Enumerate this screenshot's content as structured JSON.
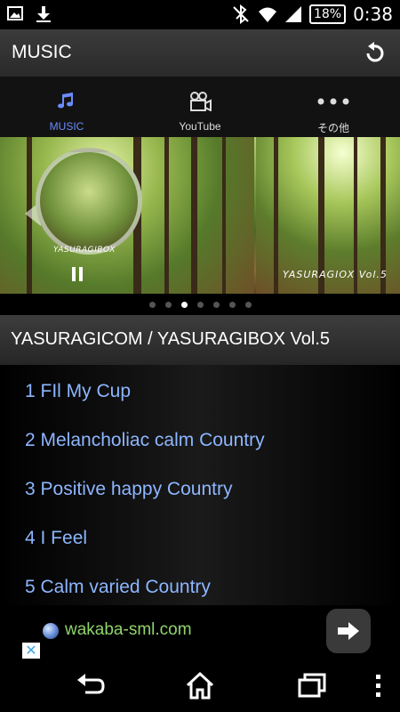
{
  "status_bar": {
    "battery": "18%",
    "time": "0:38",
    "icons": [
      "image-icon",
      "download-icon",
      "bluetooth-off-icon",
      "wifi-icon",
      "signal-icon",
      "battery-icon"
    ]
  },
  "action_bar": {
    "title": "MUSIC",
    "refresh_icon": "refresh-icon"
  },
  "tabs": [
    {
      "label": "MUSIC",
      "icon": "music-note-icon",
      "active": true
    },
    {
      "label": "YouTube",
      "icon": "video-camera-icon",
      "active": false
    },
    {
      "label": "その他",
      "icon": "more-dots-icon",
      "active": false
    }
  ],
  "carousel": {
    "left_cover_text": "YASURAGIBOX",
    "right_cover_text": "YASURAGIOX Vol.5",
    "page_count": 7,
    "active_page": 3
  },
  "album": {
    "title": "YASURAGICOM / YASURAGIBOX Vol.5"
  },
  "tracks": [
    {
      "label": "1 FIl My Cup"
    },
    {
      "label": "2 Melancholiac calm Country"
    },
    {
      "label": "3 Positive happy Country"
    },
    {
      "label": "4 I Feel"
    },
    {
      "label": "5 Calm varied Country"
    }
  ],
  "ad": {
    "link_text": "wakaba-sml.com",
    "close_label": "✕"
  },
  "colors": {
    "accent": "#6b8cff",
    "track_text": "#8db6ff",
    "ad_link": "#8fd46a"
  }
}
